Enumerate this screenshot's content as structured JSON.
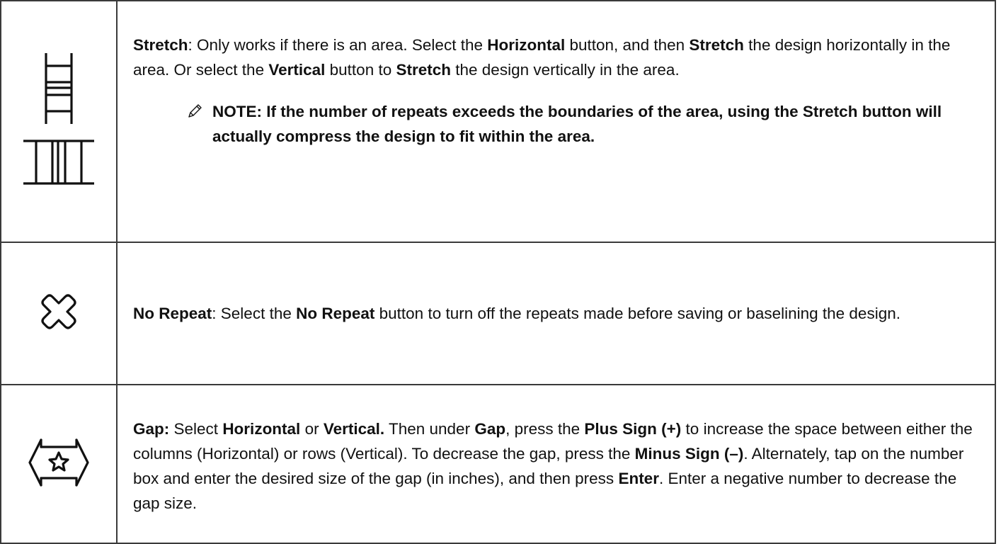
{
  "rows": [
    {
      "icons": [
        "stretch-horizontal-icon",
        "stretch-vertical-icon"
      ],
      "segments": [
        {
          "text": "Stretch",
          "bold": true
        },
        {
          "text": ": Only works if there is an area. Select the ",
          "bold": false
        },
        {
          "text": "Horizontal",
          "bold": true
        },
        {
          "text": " button, and then ",
          "bold": false
        },
        {
          "text": "Stretch",
          "bold": true
        },
        {
          "text": " the design horizontally in the area. Or select the ",
          "bold": false
        },
        {
          "text": "Vertical",
          "bold": true
        },
        {
          "text": " button to ",
          "bold": false
        },
        {
          "text": "Stretch",
          "bold": true
        },
        {
          "text": " the design vertically in the area.",
          "bold": false
        }
      ],
      "note": {
        "icon": "pencil-icon",
        "text": "NOTE: If the number of repeats exceeds the boundaries of the area, using the Stretch button will actually compress the design to fit within the area."
      }
    },
    {
      "icons": [
        "no-repeat-icon"
      ],
      "segments": [
        {
          "text": "No Repeat",
          "bold": true
        },
        {
          "text": ": Select the ",
          "bold": false
        },
        {
          "text": "No Repeat",
          "bold": true
        },
        {
          "text": " button to turn off the repeats made before saving or baselining the design.",
          "bold": false
        }
      ]
    },
    {
      "icons": [
        "gap-icon"
      ],
      "segments": [
        {
          "text": "Gap:",
          "bold": true
        },
        {
          "text": " Select ",
          "bold": false
        },
        {
          "text": "Horizontal",
          "bold": true
        },
        {
          "text": " or ",
          "bold": false
        },
        {
          "text": "Vertical.",
          "bold": true
        },
        {
          "text": " Then under ",
          "bold": false
        },
        {
          "text": "Gap",
          "bold": true
        },
        {
          "text": ", press the ",
          "bold": false
        },
        {
          "text": "Plus Sign (+)",
          "bold": true
        },
        {
          "text": " to increase the space between either the columns (Horizontal) or rows (Vertical). To decrease the gap, press the ",
          "bold": false
        },
        {
          "text": "Minus Sign (–)",
          "bold": true
        },
        {
          "text": ". Alternately, tap on the number box and enter the desired size of the gap (in inches), and then press ",
          "bold": false
        },
        {
          "text": "Enter",
          "bold": true
        },
        {
          "text": ". Enter a negative number to decrease the gap size.",
          "bold": false
        }
      ]
    }
  ]
}
